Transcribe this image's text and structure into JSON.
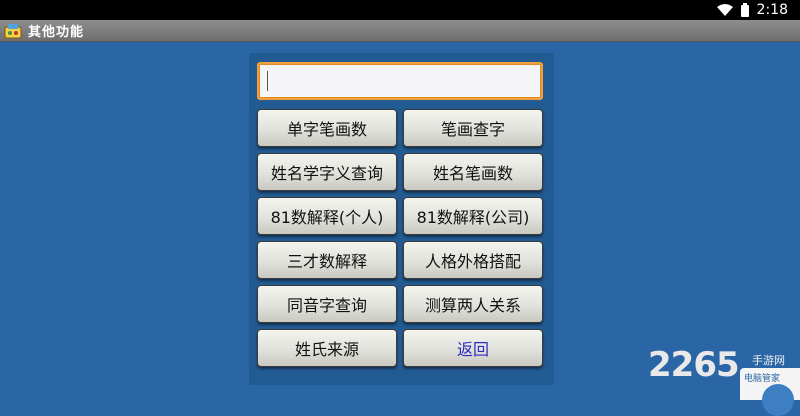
{
  "status_bar": {
    "time": "2:18",
    "wifi_icon": "wifi-icon",
    "battery_icon": "battery-icon"
  },
  "title_bar": {
    "title": "其他功能",
    "icon": "app-icon"
  },
  "input": {
    "value": "",
    "placeholder": ""
  },
  "buttons": [
    {
      "label": "单字笔画数"
    },
    {
      "label": "笔画查字"
    },
    {
      "label": "姓名学字义查询"
    },
    {
      "label": "姓名笔画数"
    },
    {
      "label": "81数解释(个人)"
    },
    {
      "label": "81数解释(公司)"
    },
    {
      "label": "三才数解释"
    },
    {
      "label": "人格外格搭配"
    },
    {
      "label": "同音字查询"
    },
    {
      "label": "测算两人关系"
    },
    {
      "label": "姓氏来源"
    },
    {
      "label": "返回"
    }
  ],
  "watermark": {
    "text": "2265",
    "sub": "手游网"
  },
  "overlay": {
    "label": "电脑管家"
  },
  "colors": {
    "background": "#2a66a6",
    "panel": "#225a92",
    "input_border": "#f0a040",
    "back_text": "#2d2dc0"
  }
}
